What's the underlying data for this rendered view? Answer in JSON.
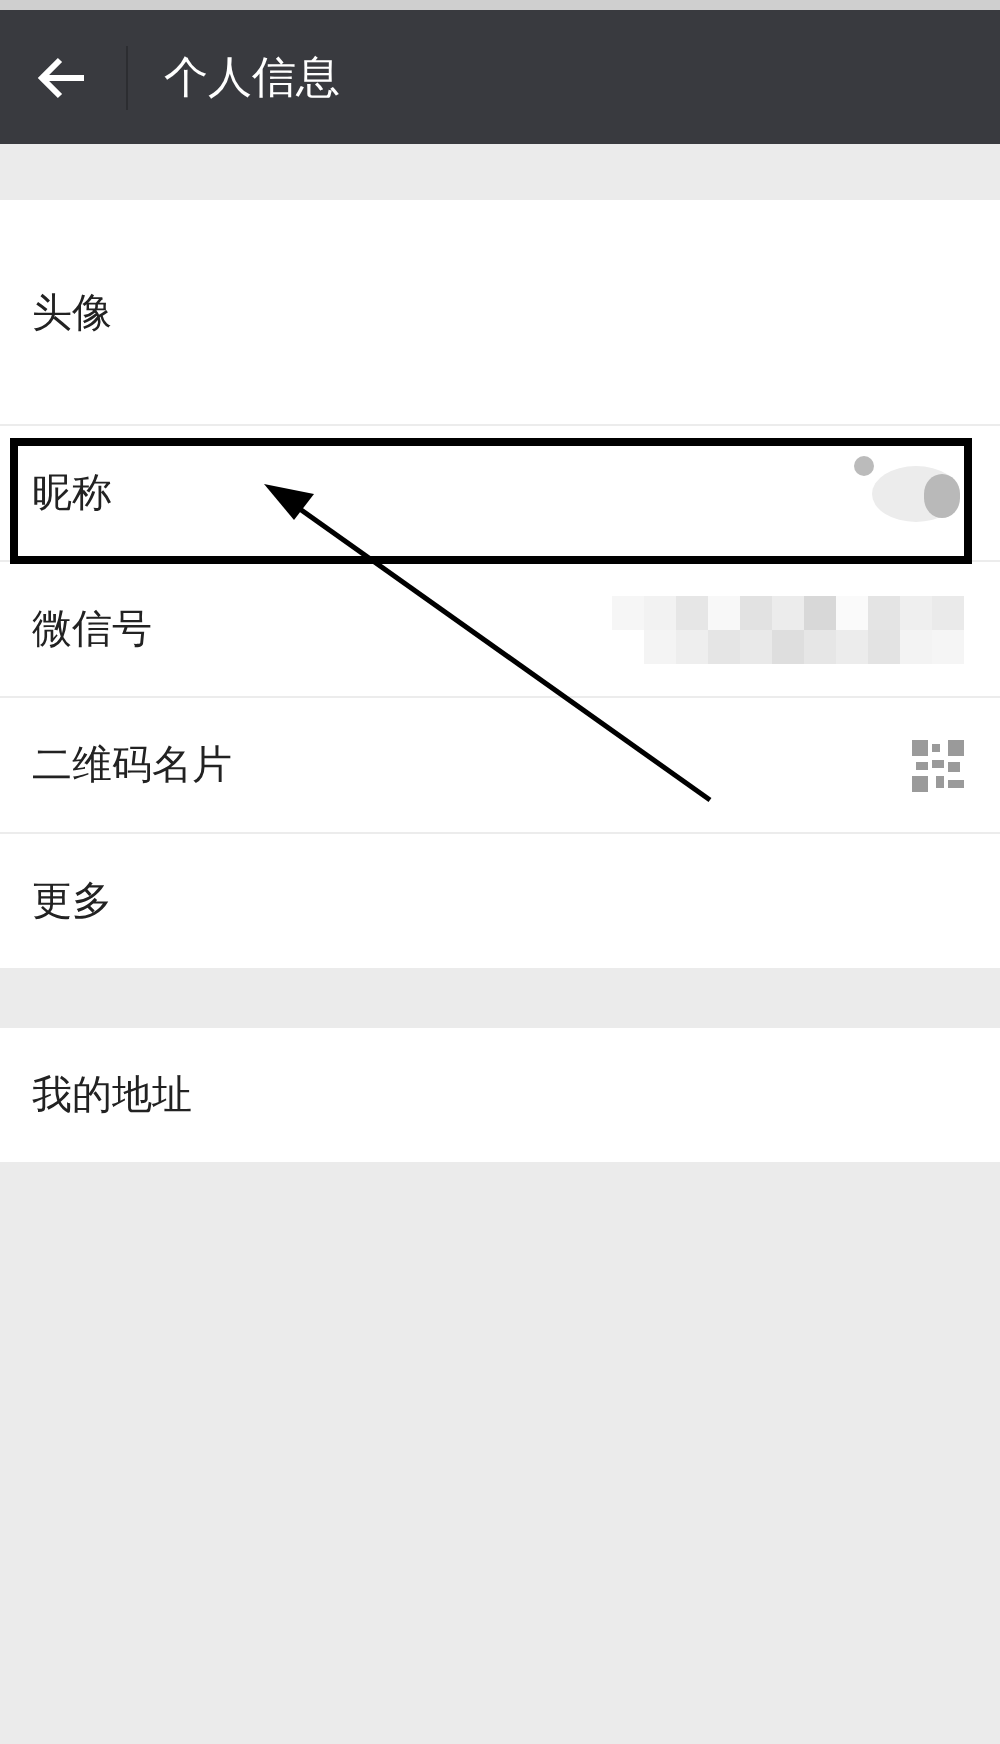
{
  "header": {
    "title": "个人信息"
  },
  "sections": [
    {
      "rows": [
        {
          "label": "头像",
          "kind": "avatar",
          "highlighted": false
        },
        {
          "label": "昵称",
          "kind": "blurred",
          "highlighted": true
        },
        {
          "label": "微信号",
          "kind": "mosaic",
          "highlighted": false
        },
        {
          "label": "二维码名片",
          "kind": "qr",
          "highlighted": false
        },
        {
          "label": "更多",
          "kind": "plain",
          "highlighted": false
        }
      ]
    },
    {
      "rows": [
        {
          "label": "我的地址",
          "kind": "plain",
          "highlighted": false
        }
      ]
    }
  ]
}
